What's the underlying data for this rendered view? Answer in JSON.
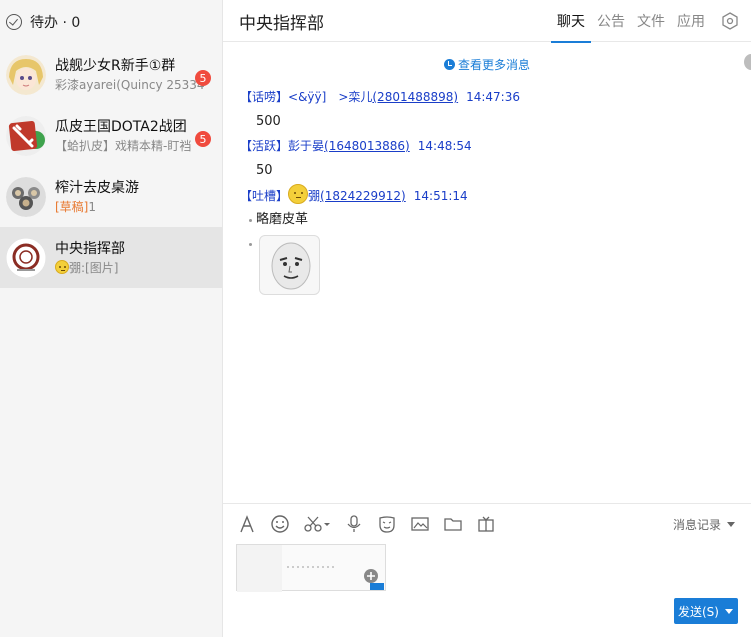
{
  "sidebar": {
    "todo_label": "待办 · 0",
    "conversations": [
      {
        "name": "战舰少女R新手①群",
        "preview": "彩漆ayarei(Quincy 25334",
        "badge": "5"
      },
      {
        "name": "瓜皮王国DOTA2战团",
        "preview": "【蛤扒皮】戏精本精-盯裆",
        "badge": "5"
      },
      {
        "name": "榨汁去皮桌游",
        "draft_tag": "[草稿]",
        "preview": "1"
      },
      {
        "name": "中央指挥部",
        "preview": "弸:[图片]",
        "active": true
      }
    ]
  },
  "header": {
    "title": "中央指挥部",
    "tabs": [
      "聊天",
      "公告",
      "文件",
      "应用"
    ],
    "active_tab": "聊天"
  },
  "chat": {
    "more_messages": "查看更多消息",
    "messages": [
      {
        "rank": "【话唠】",
        "nick": "<&ÿÿ]　>栾儿",
        "qq": "(2801488898)",
        "time": "14:47:36",
        "text": "500"
      },
      {
        "rank": "【活跃】",
        "nick": "彭于晏",
        "qq": "(1648013886)",
        "time": "14:48:54",
        "text": "50"
      },
      {
        "rank": "【吐槽】",
        "nick": "弸",
        "qq": "(1824229912)",
        "time": "14:51:14",
        "text": "略磨皮革",
        "has_image": true
      }
    ]
  },
  "input": {
    "history_label": "消息记录",
    "send_label": "发送(S)"
  },
  "colors": {
    "accent": "#1a7dd7",
    "badge": "#f04b3e",
    "draft": "#e8782f",
    "nick": "#1a3ec8"
  }
}
